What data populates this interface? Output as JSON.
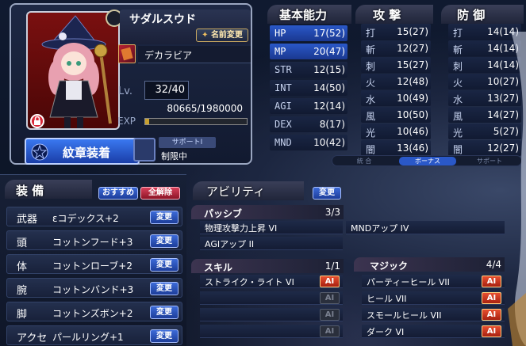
{
  "character": {
    "name": "サダルスウド",
    "rename_label": "名前変更",
    "class_name": "デカラビア",
    "level_label": "Lv.",
    "level_value": "32/40",
    "exp_label": "EXP",
    "exp_value": "80665/1980000",
    "exp_progress": 0.04
  },
  "emblem": {
    "equip_label": "紋章装着",
    "support_label": "サポートⅠ",
    "limit_label": "制限中"
  },
  "equipment": {
    "title": "装 備",
    "recommend_label": "おすすめ",
    "clear_label": "全解除",
    "change_label": "変更",
    "rows": [
      {
        "slot": "武器",
        "item": "εコデックス+2"
      },
      {
        "slot": "頭",
        "item": "コットンフード+3"
      },
      {
        "slot": "体",
        "item": "コットンローブ+2"
      },
      {
        "slot": "腕",
        "item": "コットンバンド+3"
      },
      {
        "slot": "脚",
        "item": "コットンズボン+2"
      },
      {
        "slot": "アクセ",
        "item": "パールリング+1"
      }
    ]
  },
  "basic": {
    "title": "基本能力",
    "stats": [
      {
        "label": "HP",
        "value": "17(52)"
      },
      {
        "label": "MP",
        "value": "20(47)"
      },
      {
        "label": "STR",
        "value": "12(15)"
      },
      {
        "label": "INT",
        "value": "14(50)"
      },
      {
        "label": "AGI",
        "value": "12(14)"
      },
      {
        "label": "DEX",
        "value": "8(17)"
      },
      {
        "label": "MND",
        "value": "10(42)"
      }
    ]
  },
  "attack": {
    "title": "攻 撃",
    "stats": [
      {
        "label": "打",
        "value": "15(27)"
      },
      {
        "label": "斬",
        "value": "12(27)"
      },
      {
        "label": "刺",
        "value": "15(27)"
      },
      {
        "label": "火",
        "value": "12(48)"
      },
      {
        "label": "水",
        "value": "10(49)"
      },
      {
        "label": "風",
        "value": "10(50)"
      },
      {
        "label": "光",
        "value": "10(46)"
      },
      {
        "label": "闇",
        "value": "13(46)"
      }
    ]
  },
  "defense": {
    "title": "防 御",
    "stats": [
      {
        "label": "打",
        "value": "14(14)"
      },
      {
        "label": "斬",
        "value": "14(14)"
      },
      {
        "label": "刺",
        "value": "14(14)"
      },
      {
        "label": "火",
        "value": "10(27)"
      },
      {
        "label": "水",
        "value": "13(27)"
      },
      {
        "label": "風",
        "value": "14(27)"
      },
      {
        "label": "光",
        "value": "5(27)"
      },
      {
        "label": "闇",
        "value": "12(27)"
      }
    ]
  },
  "filter_tabs": [
    {
      "label": "統 合"
    },
    {
      "label": "ボーナス"
    },
    {
      "label": "サポート"
    }
  ],
  "abilities": {
    "title": "アビリティ",
    "change_label": "変更",
    "passive": {
      "title": "パッシブ",
      "count": "3/3",
      "items": [
        "物理攻撃力上昇 VI",
        "AGIアップ II",
        "MNDアップ IV"
      ]
    },
    "skill": {
      "title": "スキル",
      "count": "1/1",
      "items": [
        "ストライク・ライト VI",
        "",
        "",
        ""
      ]
    },
    "magic": {
      "title": "マジック",
      "count": "4/4",
      "items": [
        "パーティーヒール VII",
        "ヒール VII",
        "スモールヒール VII",
        "ダーク VI"
      ]
    },
    "ai_label": "AI"
  }
}
